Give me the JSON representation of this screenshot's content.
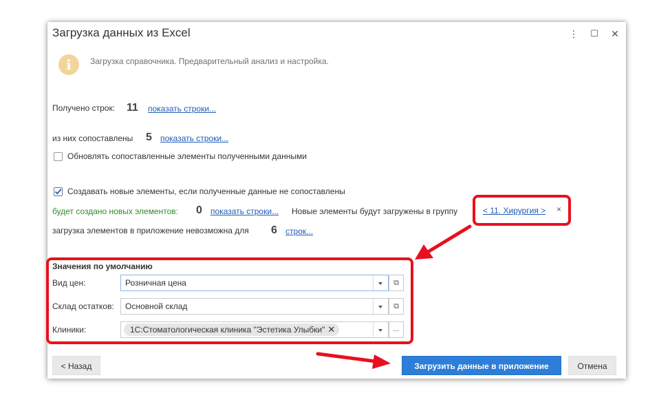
{
  "dialog": {
    "title": "Загрузка данных из Excel",
    "controls": {
      "menu": "⋮",
      "maximize": "☐",
      "close": "✕"
    }
  },
  "info": {
    "icon": "i",
    "text": "Загрузка справочника. Предварительный анализ и настройка."
  },
  "stats": {
    "received_label": "Получено строк:",
    "received_count": "11",
    "received_link": "показать строки...",
    "matched_label": "из них сопоставлены",
    "matched_count": "5",
    "matched_link": "показать строки..."
  },
  "options": {
    "update_label": "Обновлять сопоставленные элементы полученными данными",
    "update_checked": false,
    "create_label": "Создавать новые элементы, если полученные данные не сопоставлены",
    "create_checked": true
  },
  "new_elements": {
    "label": "будет создано новых элементов:",
    "count": "0",
    "link": "показать строки...",
    "group_text": "Новые элементы будут загружены в группу",
    "group_value": "< 11. Хирургия >",
    "group_clear": "×"
  },
  "impossible": {
    "label": "загрузка элементов в приложение невозможна для",
    "count": "6",
    "link": "строк..."
  },
  "defaults": {
    "title": "Значения по умолчанию",
    "price_label": "Вид цен:",
    "price_value": "Розничная цена",
    "warehouse_label": "Склад остатков:",
    "warehouse_value": "Основной склад",
    "clinics_label": "Клиники:",
    "clinics_tag": "1С:Стоматологическая клиника \"Эстетика Улыбки\"",
    "tag_remove": "✕",
    "more": "..."
  },
  "buttons": {
    "back": "< Назад",
    "load": "Загрузить данные в приложение",
    "cancel": "Отмена"
  },
  "colors": {
    "accent_blue": "#2c7ed8",
    "highlight_red": "#e8101e",
    "link_blue": "#1f5ab7",
    "success_green": "#2f8a2f",
    "info_icon": "#f3d59b"
  }
}
